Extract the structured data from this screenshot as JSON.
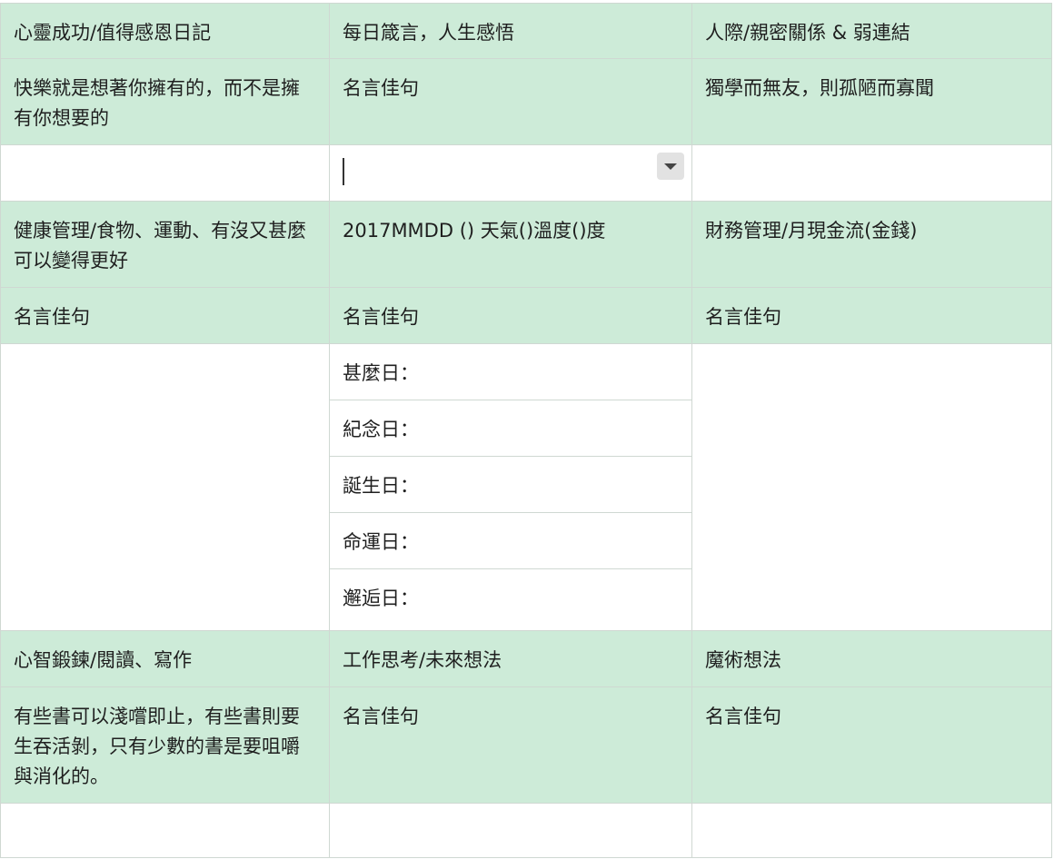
{
  "rows": {
    "r0": [
      "心靈成功/值得感恩日記",
      "每日箴言，人生感悟",
      "人際/親密關係 & 弱連結"
    ],
    "r1": [
      "快樂就是想著你擁有的，而不是擁有你想要的",
      "名言佳句",
      "獨學而無友，則孤陋而寡聞"
    ],
    "r3": [
      "健康管理/食物、運動、有沒又甚麼可以變得更好",
      "2017MMDD () 天氣()溫度()度",
      "財務管理/月現金流(金錢)"
    ],
    "r4": [
      "名言佳句",
      "名言佳句",
      "名言佳句"
    ],
    "r6": [
      "心智鍛鍊/閱讀、寫作",
      "工作思考/未來想法",
      "魔術想法"
    ],
    "r7": [
      "有些書可以淺嚐即止，有些書則要生吞活剝，只有少數的書是要咀嚼與消化的。",
      "名言佳句",
      "名言佳句"
    ]
  },
  "date_list": [
    "甚麼日：",
    "紀念日：",
    "誕生日：",
    "命運日：",
    "邂逅日："
  ],
  "dropdown": {
    "value": "",
    "icon": "chevron-down-icon"
  },
  "colors": {
    "green": "#cdebd8",
    "white": "#ffffff",
    "border": "#cfd8d2"
  }
}
